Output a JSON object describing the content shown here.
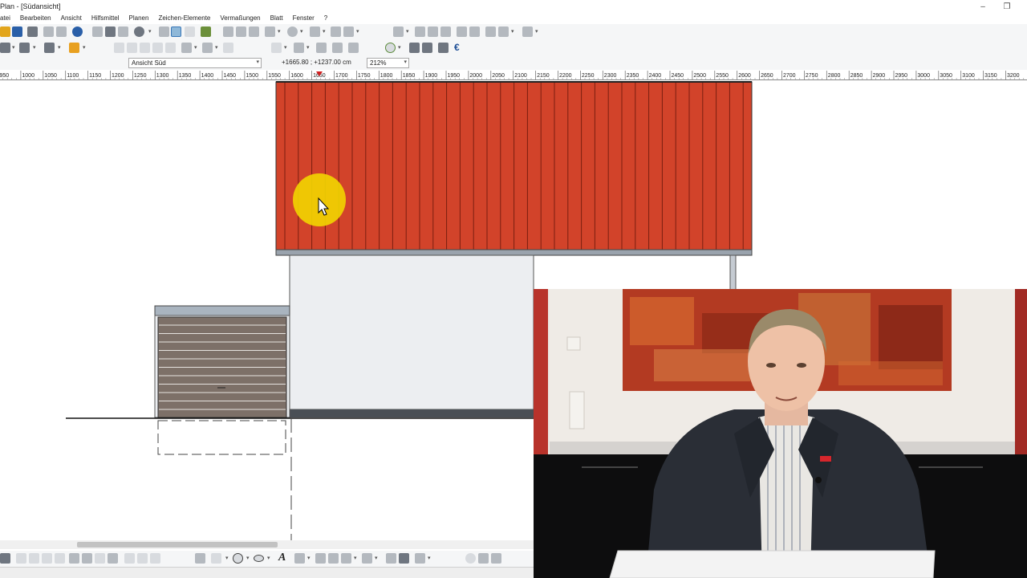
{
  "window": {
    "title": "Plan - [Südansicht]",
    "controls": [
      "–",
      "❐"
    ]
  },
  "menu": {
    "items": [
      "atei",
      "Bearbeiten",
      "Ansicht",
      "Hilfsmittel",
      "Planen",
      "Zeichen-Elemente",
      "Vermaßungen",
      "Blatt",
      "Fenster",
      "?"
    ]
  },
  "toolbar3": {
    "view_select": "Ansicht Süd",
    "coordinates": "+1665.80 ; +1237.00 cm",
    "zoom": "212%"
  },
  "ruler": {
    "labels": [
      "950",
      "1000",
      "1050",
      "1100",
      "1150",
      "1200",
      "1250",
      "1300",
      "1350",
      "1400",
      "1450",
      "1500",
      "1550",
      "1600",
      "1650",
      "1700",
      "1750",
      "1800",
      "1850",
      "1900",
      "1950",
      "2000",
      "2050",
      "2100",
      "2150",
      "2200",
      "2250",
      "2300",
      "2350",
      "2400",
      "2450",
      "2500",
      "2550",
      "2600",
      "2650",
      "2700",
      "2750",
      "2800",
      "2850",
      "2900",
      "2950",
      "3000",
      "3050",
      "3100",
      "3150",
      "3200"
    ]
  },
  "drawing": {
    "roof_color": "#d2432a",
    "wall_color": "#eceef1",
    "garage_door_color": "#7d7068",
    "cursor_highlight": "#f2d600"
  },
  "icons": {
    "bottom_text_tool": "A",
    "euro_tool": "€"
  }
}
